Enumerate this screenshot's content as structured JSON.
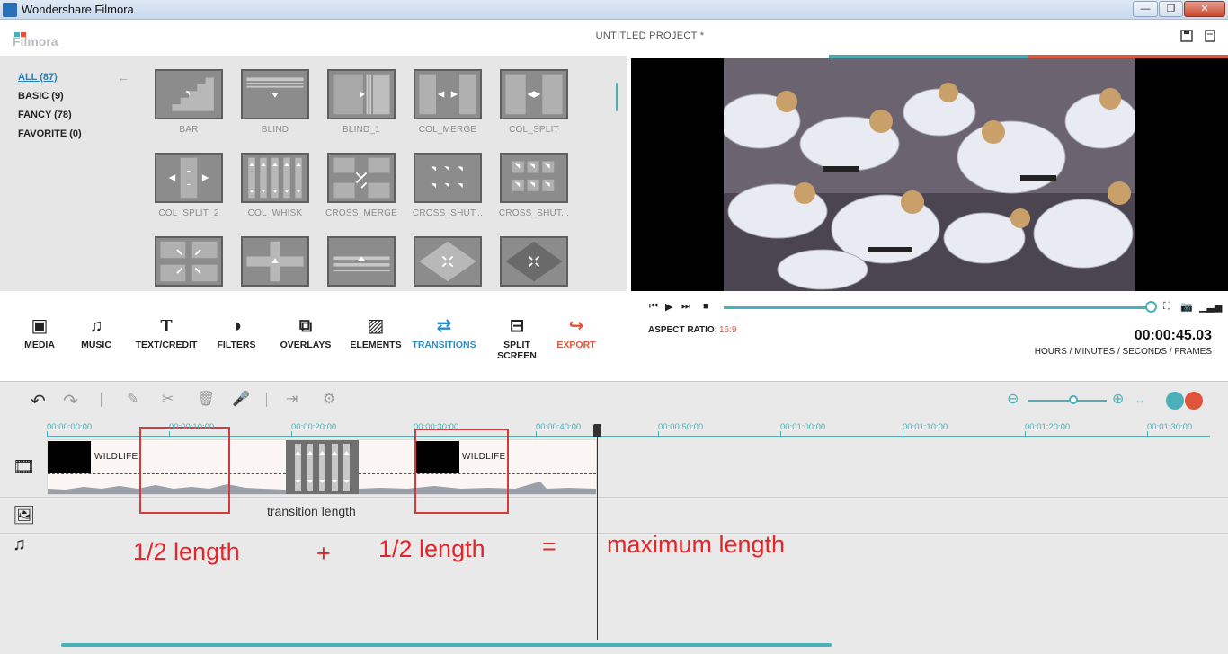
{
  "window": {
    "title": "Wondershare Filmora",
    "minimize": "—",
    "maximize": "❐",
    "close": "✕"
  },
  "header": {
    "logo": "Filmora",
    "project_title": "UNTITLED PROJECT *"
  },
  "categories": [
    {
      "label": "ALL (87)",
      "active": true
    },
    {
      "label": "BASIC (9)",
      "active": false
    },
    {
      "label": "FANCY (78)",
      "active": false
    },
    {
      "label": "FAVORITE (0)",
      "active": false
    }
  ],
  "transitions": [
    {
      "label": "BAR",
      "icon": "bar-icon"
    },
    {
      "label": "BLIND",
      "icon": "blind-icon"
    },
    {
      "label": "BLIND_1",
      "icon": "blind-1-icon"
    },
    {
      "label": "COL_MERGE",
      "icon": "col-merge-icon"
    },
    {
      "label": "COL_SPLIT",
      "icon": "col-split-icon"
    },
    {
      "label": "COL_SPLIT_2",
      "icon": "col-split-2-icon"
    },
    {
      "label": "COL_WHISK",
      "icon": "col-whisk-icon"
    },
    {
      "label": "CROSS_MERGE",
      "icon": "cross-merge-icon"
    },
    {
      "label": "CROSS_SHUT...",
      "icon": "cross-shutter-icon"
    },
    {
      "label": "CROSS_SHUT...",
      "icon": "cross-shutter-2-icon"
    },
    {
      "label": "",
      "icon": "cross-expand-icon"
    },
    {
      "label": "",
      "icon": "cross-whisk-icon"
    },
    {
      "label": "",
      "icon": "push-up-icon"
    },
    {
      "label": "",
      "icon": "diamond-icon"
    },
    {
      "label": "",
      "icon": "diamond-2-icon"
    }
  ],
  "toolbar": {
    "items": [
      {
        "label": "MEDIA",
        "icon": "media-icon"
      },
      {
        "label": "MUSIC",
        "icon": "music-icon"
      },
      {
        "label": "TEXT/CREDIT",
        "icon": "text-icon"
      },
      {
        "label": "FILTERS",
        "icon": "filters-icon"
      },
      {
        "label": "OVERLAYS",
        "icon": "overlays-icon"
      },
      {
        "label": "ELEMENTS",
        "icon": "elements-icon"
      },
      {
        "label": "TRANSITIONS",
        "icon": "transitions-icon",
        "active": true
      },
      {
        "label": "SPLIT SCREEN",
        "icon": "split-screen-icon"
      },
      {
        "label": "EXPORT",
        "icon": "export-icon"
      }
    ]
  },
  "player": {
    "aspect_label": "ASPECT RATIO:",
    "aspect_value": "16:9",
    "timecode": "00:00:45.03",
    "timecode_units": "HOURS / MINUTES / SECONDS / FRAMES",
    "seek_progress": 1.0
  },
  "timeline": {
    "ticks": [
      "00:00:00:00",
      "00:00:10:00",
      "00:00:20:00",
      "00:00:30:00",
      "00:00:40:00",
      "00:00:50:00",
      "00:01:00:00",
      "00:01:10:00",
      "00:01:20:00",
      "00:01:30:00"
    ],
    "clip1_name": "WILDLIFE",
    "clip2_name": "WILDLIFE",
    "transition_note": "transition length",
    "half1": "1/2 length",
    "plus": "+",
    "half2": "1/2 length",
    "equals": "=",
    "maximum": "maximum length"
  },
  "colors": {
    "accent": "#4ab1ba",
    "export": "#e0553a",
    "annotation": "#e4262a"
  }
}
